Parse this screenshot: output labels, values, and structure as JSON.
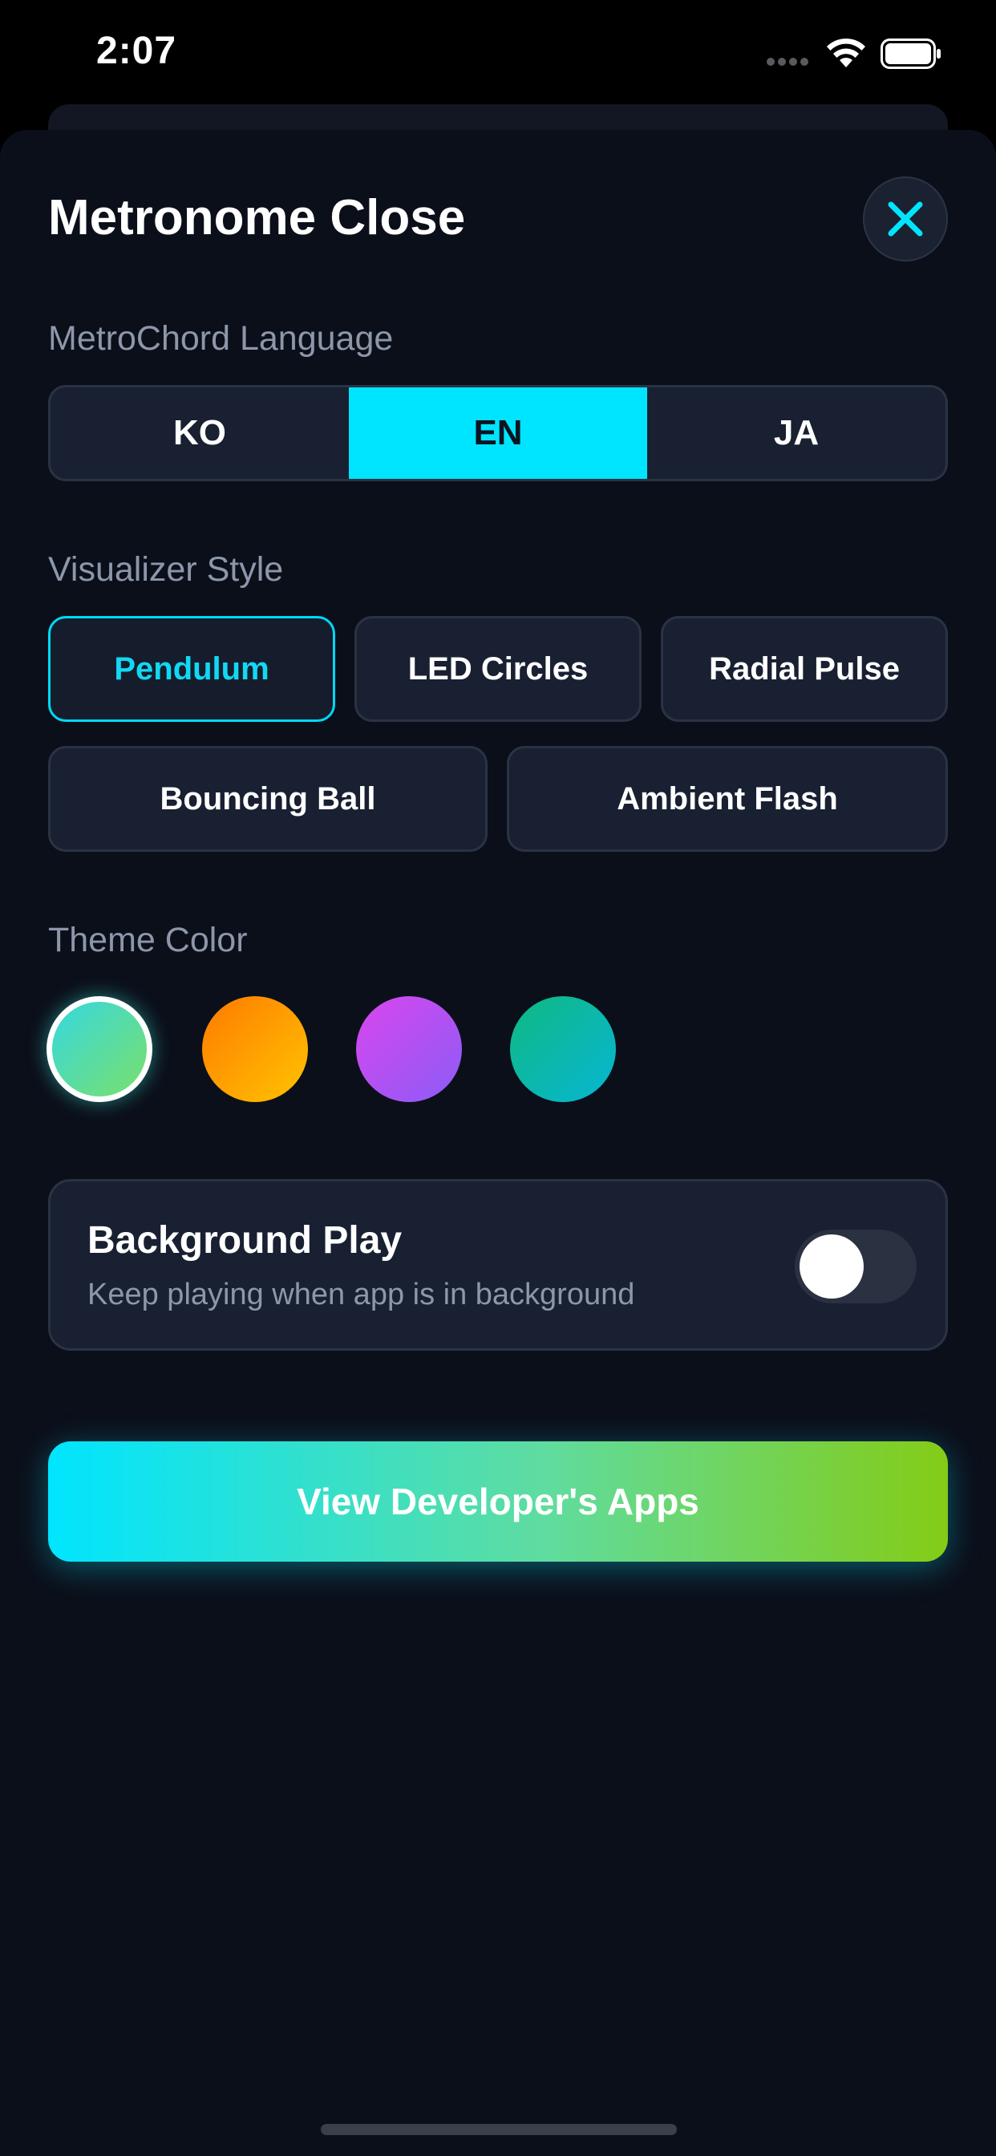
{
  "status_bar": {
    "time": "2:07"
  },
  "header": {
    "title": "Metronome Close",
    "close_icon": "close-icon",
    "accent_color": "#00e5ff"
  },
  "language": {
    "label": "MetroChord Language",
    "options": [
      "KO",
      "EN",
      "JA"
    ],
    "selected": "EN"
  },
  "visualizer": {
    "label": "Visualizer Style",
    "options": [
      "Pendulum",
      "LED Circles",
      "Radial Pulse",
      "Bouncing Ball",
      "Ambient Flash"
    ],
    "selected": "Pendulum"
  },
  "theme": {
    "label": "Theme Color",
    "swatches": [
      {
        "name": "cyan-green",
        "from": "#35d8e0",
        "to": "#7ae06a"
      },
      {
        "name": "orange",
        "from": "#ff7a00",
        "to": "#ffc400"
      },
      {
        "name": "purple",
        "from": "#d946ef",
        "to": "#8b5cf6"
      },
      {
        "name": "teal",
        "from": "#10b981",
        "to": "#06b6d4"
      }
    ],
    "selected_index": 0
  },
  "background_play": {
    "title": "Background Play",
    "subtitle": "Keep playing when app is in background",
    "enabled": false
  },
  "cta": {
    "label": "View Developer's Apps"
  }
}
